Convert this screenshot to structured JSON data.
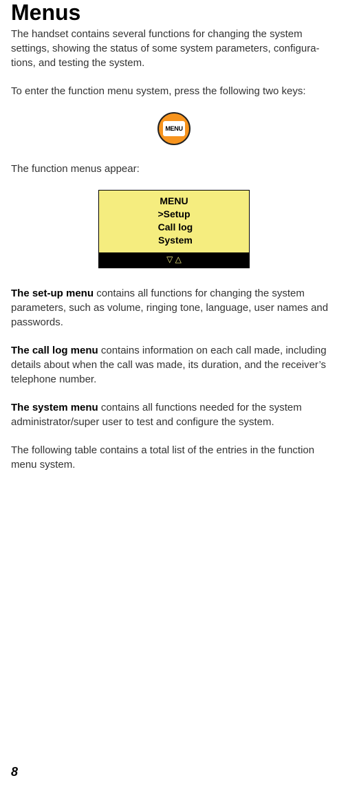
{
  "heading": "Menus",
  "intro": "The handset contains several functions for changing the system settings, showing the status of some system parameters, configura­tions, and testing the system.",
  "instruction": "To enter the function menu system, press the following two keys:",
  "menu_button_label": "MENU",
  "menus_appear": "The function menus appear:",
  "lcd": {
    "title": "MENU",
    "line1": ">Setup",
    "line2": " Call log",
    "line3": " System",
    "arrows": "▽ △"
  },
  "desc": {
    "setup": {
      "bold": "The set-up menu ",
      "text": "contains all functions for changing the system parameters, such as volume, ringing tone, language, user names and passwords."
    },
    "calllog": {
      "bold": "The call log menu ",
      "text": "contains information on each call made, includ­ing details about when the call was made, its duration, and the receiver’s telephone number."
    },
    "system": {
      "bold": "The system menu ",
      "text": "contains all functions needed for the system administrator/super user to test and configure the system."
    }
  },
  "table_intro": "The following table contains a total list of the entries in the function menu system.",
  "page_number": "8"
}
